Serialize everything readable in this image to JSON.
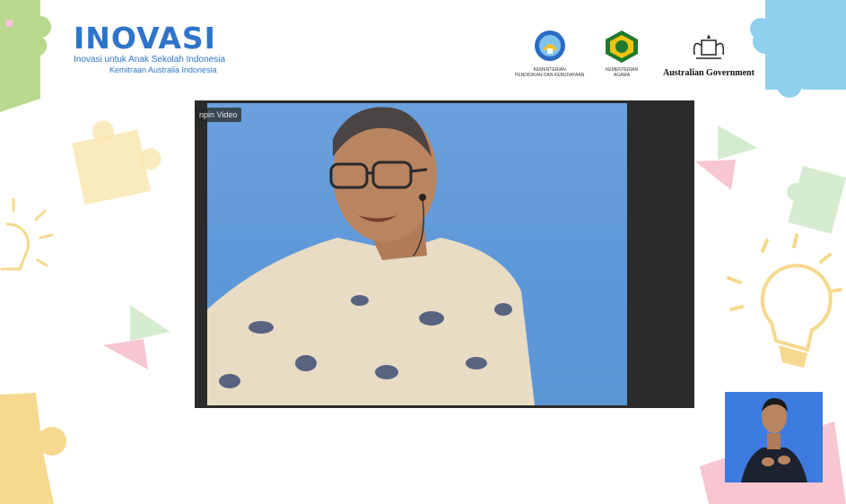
{
  "brand": {
    "title": "INOVASI",
    "subtitle": "Inovasi untuk Anak Sekolah Indonesia",
    "partnership": "Kemitraan Australia Indonesia"
  },
  "logos": [
    {
      "name": "kemendikbud",
      "caption_line1": "KEMENTERIAN",
      "caption_line2": "PENDIDIKAN DAN KEBUDAYAAN"
    },
    {
      "name": "kemenag",
      "caption_line1": "KEMENTERIAN",
      "caption_line2": "AGAMA"
    },
    {
      "name": "australian-government",
      "caption": "Australian Government"
    }
  ],
  "video": {
    "name_label": "npin Video"
  },
  "colors": {
    "brand_blue": "#2e74c9",
    "video_bg": "#5d97d8",
    "video_frame": "#2b2b2b",
    "interpreter_bg": "#3d7be0"
  }
}
